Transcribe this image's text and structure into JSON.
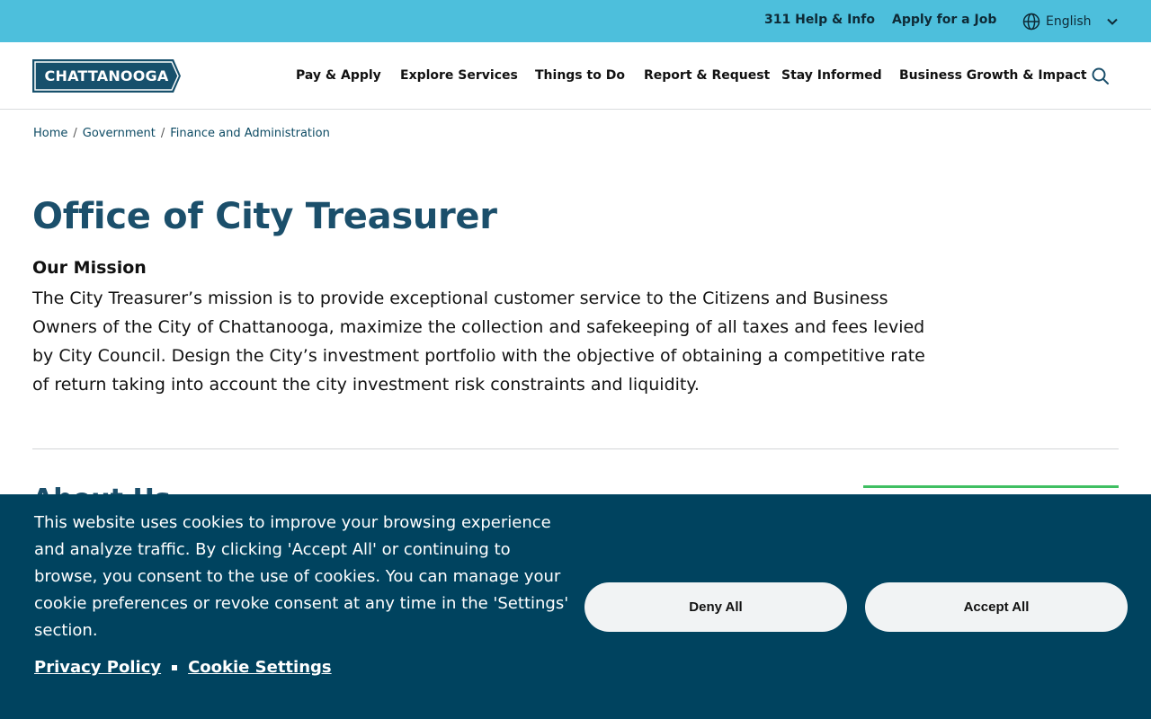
{
  "utility": {
    "help_label": "311 Help & Info",
    "job_label": "Apply for a Job",
    "language": "English",
    "icons": {
      "language": "globe-icon",
      "dropdown": "chevron-down-icon"
    }
  },
  "header": {
    "logo_text": "CHATTANOOGA",
    "nav": [
      {
        "label": "Pay & Apply"
      },
      {
        "label": "Explore Services"
      },
      {
        "label": "Things to Do"
      },
      {
        "label": "Report & Request"
      },
      {
        "label": "Stay Informed"
      },
      {
        "label": "Business Growth & Impact"
      }
    ],
    "search_icon": "search-icon"
  },
  "breadcrumb": {
    "items": [
      "Home",
      "Government",
      "Finance and Administration"
    ],
    "separator": "/"
  },
  "main": {
    "title": "Office of City Treasurer",
    "mission_heading": "Our Mission",
    "mission_body": "The City Treasurer’s mission is to provide exceptional customer service to the Citizens and Business Owners of the City of Chattanooga, maximize the collection and safekeeping of all taxes and fees levied by City Council. Design the City’s investment portfolio with the objective of obtaining a competitive rate of return taking into account the city investment risk constraints and liquidity.",
    "about_heading": "About Us"
  },
  "cookie": {
    "text": "This website uses cookies to improve your browsing experience and analyze traffic. By clicking 'Accept All' or continuing to browse, you consent to the use of cookies. You can manage your cookie preferences or revoke consent at any time in the 'Settings' section.",
    "privacy_label": "Privacy Policy",
    "settings_label": "Cookie Settings",
    "deny_label": "Deny All",
    "accept_label": "Accept All"
  },
  "colors": {
    "utility_bar": "#4dbfdc",
    "brand_navy": "#1b4f6b",
    "logo_bg": "#17506c",
    "cookie_bg": "#00435f",
    "accent_green": "#3fbf62"
  }
}
